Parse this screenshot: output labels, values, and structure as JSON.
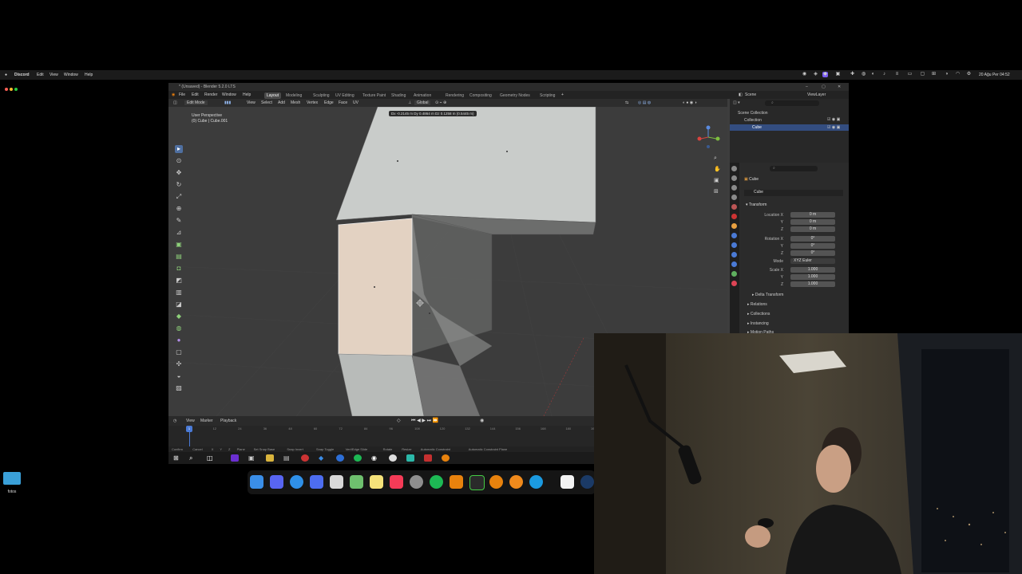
{
  "mac_menu": {
    "app": "Discord",
    "items": [
      "Edit",
      "View",
      "Window",
      "Help"
    ],
    "clock": "20 Ağu Per 04:52"
  },
  "blender": {
    "title": "* (Unsaved) - Blender 5.2.0 LTS",
    "menus": [
      "File",
      "Edit",
      "Render",
      "Window",
      "Help"
    ],
    "workspaces": [
      "Layout",
      "Modeling",
      "Sculpting",
      "UV Editing",
      "Texture Paint",
      "Shading",
      "Animation",
      "Rendering",
      "Compositing",
      "Geometry Nodes",
      "Scripting"
    ],
    "active_workspace": "Layout",
    "scene": "Scene",
    "view_layer": "ViewLayer",
    "header": {
      "mode": "Edit Mode",
      "menus": [
        "View",
        "Select",
        "Add",
        "Mesh",
        "Vertex",
        "Edge",
        "Face",
        "UV"
      ],
      "transform_orientation": "Global",
      "readout": "Dx -0.2145 m  Dy 0.4864 m  Dz 0.1258 m (0.5445 m)"
    },
    "viewport": {
      "perspective": "User Perspective",
      "object_line": "(0) Cube | Cube.001"
    },
    "outliner": {
      "search": "",
      "items": [
        "Scene Collection",
        "Collection",
        "Cube"
      ]
    },
    "properties": {
      "object_name": "Cube",
      "data_name": "Cube",
      "panel": "Transform",
      "location": {
        "label": "Location X",
        "x": "0 m",
        "y": "0 m",
        "z": "0 m"
      },
      "rotation": {
        "label": "Rotation X",
        "x": "0°",
        "y": "0°",
        "z": "0°"
      },
      "mode_label": "Mode",
      "mode_value": "XYZ Euler",
      "scale": {
        "label": "Scale X",
        "x": "1.000",
        "y": "1.000",
        "z": "1.000"
      },
      "axis_y": "Y",
      "axis_z": "Z",
      "sections": [
        "Delta Transform",
        "Relations",
        "Collections",
        "Instancing",
        "Motion Paths"
      ]
    },
    "timeline": {
      "menus": [
        "View",
        "Marker",
        "Playback"
      ],
      "frames": [
        "1",
        "12",
        "24",
        "36",
        "48",
        "60",
        "72",
        "84",
        "96",
        "108",
        "120",
        "132",
        "144",
        "156",
        "168",
        "180",
        "192"
      ],
      "current_frame": "1"
    },
    "status": [
      "Confirm",
      "Cancel",
      "X",
      "Y",
      "Z",
      "Plane",
      "Set Snap Base",
      "Snap Invert",
      "Snap Toggle",
      "Vert/Edge Slide",
      "Rotate",
      "Resize",
      "Automatic Constraint",
      "Automatic Constraint Plane"
    ]
  },
  "desktop": {
    "folder_label": "fotos"
  },
  "colors": {
    "selected_face": "#e3d2c2",
    "mesh_light": "#c9ccca",
    "viewport_bg": "#3c3c3c",
    "accent": "#4f6fa0"
  },
  "dock_apps": [
    "finder-icon",
    "discord-icon",
    "safari-icon",
    "app-icon",
    "launchpad-icon",
    "maps-icon",
    "notes-icon",
    "music-icon",
    "settings-icon",
    "spotify-icon",
    "blender-icon",
    "activity-icon",
    "blender-icon",
    "blender-icon",
    "photos-icon",
    "vpn-icon",
    "steam-icon"
  ]
}
